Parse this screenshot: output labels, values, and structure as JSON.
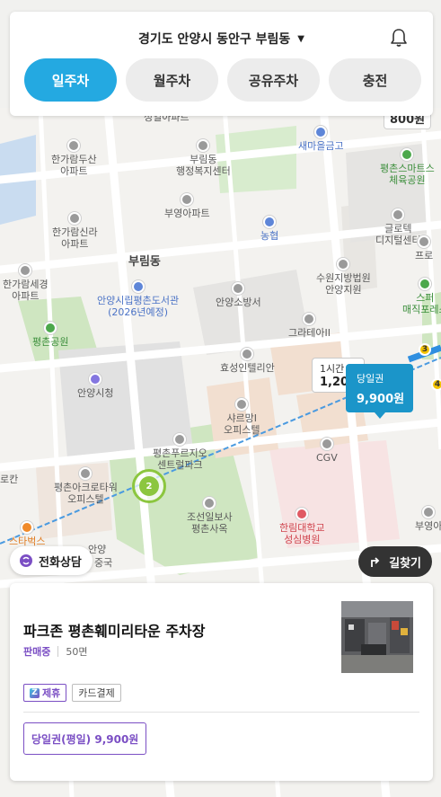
{
  "header": {
    "location": "경기도 안양시 동안구 부림동",
    "tabs": [
      {
        "label": "일주차",
        "active": true
      },
      {
        "label": "월주차",
        "active": false
      },
      {
        "label": "공유주차",
        "active": false
      },
      {
        "label": "충전",
        "active": false
      }
    ]
  },
  "map": {
    "area_label": "부림동",
    "top_price": "800원",
    "pois": [
      {
        "name": "성일아파트"
      },
      {
        "name": "새마을금고"
      },
      {
        "name": "평촌스마트스\n체육공원"
      },
      {
        "name": "한가람두산\n아파트"
      },
      {
        "name": "부림동\n행정복지센터"
      },
      {
        "name": "부영아파트"
      },
      {
        "name": "글로텍\n디지털센터"
      },
      {
        "name": "한가람신라\n아파트"
      },
      {
        "name": "농협"
      },
      {
        "name": "프로"
      },
      {
        "name": "한가람세경\n아파트"
      },
      {
        "name": "안양시립평촌도서관\n(2026년예정)"
      },
      {
        "name": "수원지방법원\n안양지원"
      },
      {
        "name": "스퍼\n매직포레스"
      },
      {
        "name": "안양소방서"
      },
      {
        "name": "평촌공원"
      },
      {
        "name": "그라테아II"
      },
      {
        "name": "효성인텔리안"
      },
      {
        "name": "안양시청"
      },
      {
        "name": "샤르망I\n오피스텔"
      },
      {
        "name": "CGV"
      },
      {
        "name": "평촌푸르지오\n센트럴파크"
      },
      {
        "name": "평촌아크로타워\n오피스텔"
      },
      {
        "name": "조선일보사\n평촌사옥"
      },
      {
        "name": "한림대학교\n성심병원"
      },
      {
        "name": "부영아"
      },
      {
        "name": "스타벅스"
      },
      {
        "name": "안양"
      },
      {
        "name": "중국"
      },
      {
        "name": "로칸"
      }
    ],
    "hourly_bubble": {
      "label": "1시간 ?",
      "price": "1,200"
    },
    "selected_bubble": {
      "label": "당일권",
      "price": "9,900원"
    },
    "cluster_count": "2",
    "subway_markers": [
      "3",
      "4"
    ]
  },
  "buttons": {
    "call": "전화상담",
    "directions": "길찾기"
  },
  "lot": {
    "name": "파크존 평촌훼미리타운 주차장",
    "status": "판매중",
    "slots": "50면",
    "tags": [
      "제휴",
      "카드결제"
    ],
    "ticket": "당일권(평일) 9,900원"
  },
  "colors": {
    "accent": "#24a9e1",
    "purple": "#7b4fc4",
    "selected_bubble": "#1b95c9",
    "cluster": "#8cc63f"
  }
}
